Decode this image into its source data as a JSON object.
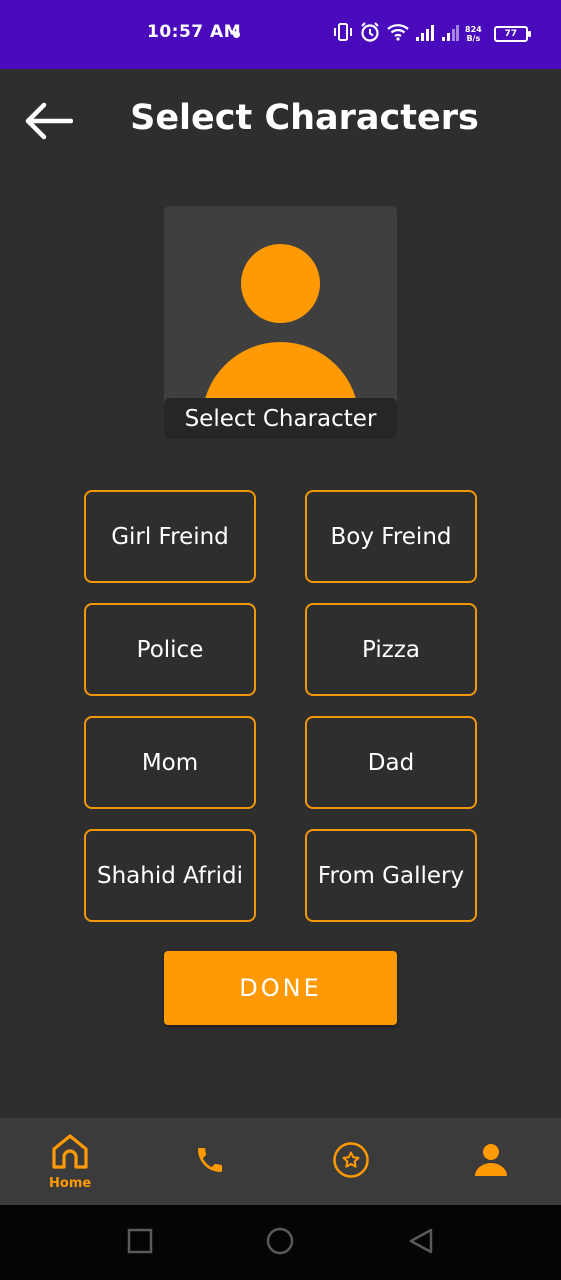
{
  "status_bar": {
    "time": "10:57 AM",
    "net_speed_value": "824",
    "net_speed_unit": "B/s",
    "battery_level": "77",
    "background_color": "#4a0bbd"
  },
  "header": {
    "title": "Select Characters",
    "back_icon": "arrow-left-icon"
  },
  "avatar": {
    "icon": "person-icon",
    "caption": "Select Character"
  },
  "characters": [
    {
      "label": "Girl Freind"
    },
    {
      "label": "Boy Freind"
    },
    {
      "label": "Police"
    },
    {
      "label": "Pizza"
    },
    {
      "label": "Mom"
    },
    {
      "label": "Dad"
    },
    {
      "label": "Shahid Afridi"
    },
    {
      "label": "From Gallery"
    }
  ],
  "done_button": {
    "label": "DONE"
  },
  "bottom_nav": {
    "items": [
      {
        "icon": "home-icon",
        "label": "Home",
        "active": true
      },
      {
        "icon": "phone-icon"
      },
      {
        "icon": "star-icon"
      },
      {
        "icon": "user-icon"
      }
    ]
  },
  "theme": {
    "accent": "#ff9a05",
    "background": "#2e2e2e",
    "nav_background": "#3b3b3b"
  }
}
